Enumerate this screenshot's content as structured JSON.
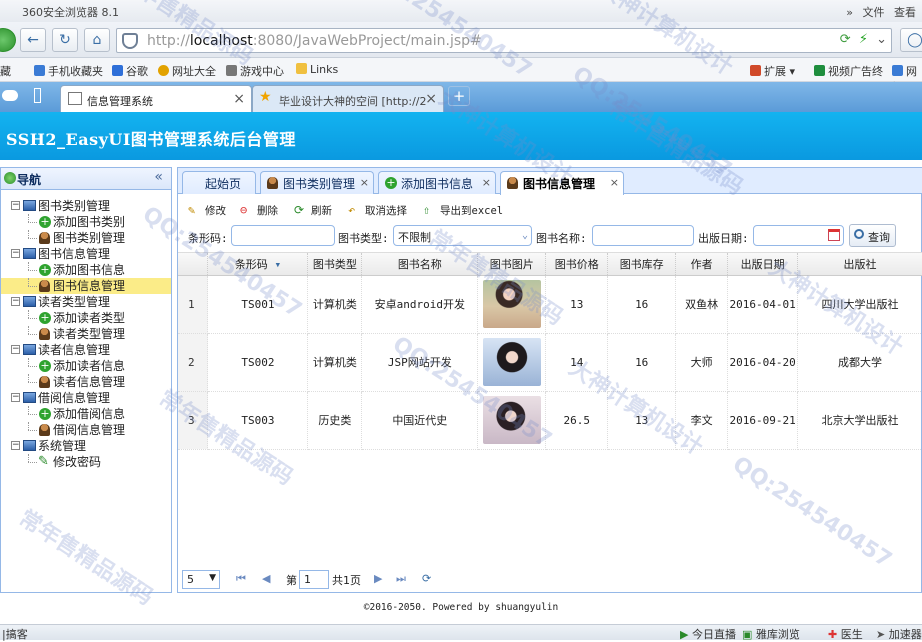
{
  "browser": {
    "window_title": "360安全浏览器 8.1",
    "menu_right": [
      "»",
      "文件",
      "查看"
    ],
    "url_prefix": "http://",
    "url_host": "localhost",
    "url_rest": ":8080/JavaWebProject/main.jsp#",
    "bookmarks": [
      "藏",
      "手机收藏夹",
      "谷歌",
      "网址大全",
      "游戏中心",
      "Links"
    ],
    "bookmarks_right": [
      "扩展",
      "视频广告终",
      "网银"
    ],
    "tabs": [
      {
        "title": "信息管理系统",
        "close": "×"
      },
      {
        "title": "毕业设计大神的空间 [http://2",
        "close": "×"
      }
    ],
    "new_tab": "+"
  },
  "app": {
    "header_title": "SSH2_EasyUI图书管理系统后台管理",
    "nav_title": "导航",
    "nav_collapse": "«",
    "tree": [
      {
        "label": "图书类别管理",
        "children": [
          "添加图书类别",
          "图书类别管理"
        ]
      },
      {
        "label": "图书信息管理",
        "children": [
          "添加图书信息",
          "图书信息管理"
        ]
      },
      {
        "label": "读者类型管理",
        "children": [
          "添加读者类型",
          "读者类型管理"
        ]
      },
      {
        "label": "读者信息管理",
        "children": [
          "添加读者信息",
          "读者信息管理"
        ]
      },
      {
        "label": "借阅信息管理",
        "children": [
          "添加借阅信息",
          "借阅信息管理"
        ]
      },
      {
        "label": "系统管理",
        "children": [
          "修改密码"
        ]
      }
    ],
    "selected_item": "图书信息管理"
  },
  "panel_tabs": [
    {
      "label": "起始页"
    },
    {
      "label": "图书类别管理",
      "close": "×"
    },
    {
      "label": "添加图书信息",
      "close": "×"
    },
    {
      "label": "图书信息管理",
      "close": "×"
    }
  ],
  "toolbar": {
    "edit": "修改",
    "delete": "删除",
    "refresh": "刷新",
    "cancel_select": "取消选择",
    "export": "导出到excel"
  },
  "search": {
    "barcode_label": "条形码:",
    "type_label": "图书类型:",
    "type_value": "不限制",
    "name_label": "图书名称:",
    "date_label": "出版日期:",
    "query_button": "查询"
  },
  "table": {
    "columns": [
      "条形码",
      "图书类型",
      "图书名称",
      "图书图片",
      "图书价格",
      "图书库存",
      "作者",
      "出版日期",
      "出版社"
    ],
    "sort_indicator": "▾",
    "rows": [
      {
        "num": "1",
        "barcode": "TS001",
        "type": "计算机类",
        "name": "安卓android开发",
        "price": "13",
        "stock": "16",
        "author": "双鱼林",
        "date": "2016-04-01",
        "publisher": "四川大学出版社"
      },
      {
        "num": "2",
        "barcode": "TS002",
        "type": "计算机类",
        "name": "JSP网站开发",
        "price": "14",
        "stock": "16",
        "author": "大师",
        "date": "2016-04-20",
        "publisher": "成都大学"
      },
      {
        "num": "3",
        "barcode": "TS003",
        "type": "历史类",
        "name": "中国近代史",
        "price": "26.5",
        "stock": "13",
        "author": "李文",
        "date": "2016-09-21",
        "publisher": "北京大学出版社"
      }
    ]
  },
  "pager": {
    "page_size": "5",
    "page_label": "第",
    "page_value": "1",
    "total_pages": "共1页"
  },
  "footer": "©2016-2050. Powered by shuangyulin",
  "status_bar": {
    "left": "|搞客",
    "right": [
      "今日直播",
      "雅库浏览",
      "医生",
      "加速器"
    ]
  },
  "watermarks": [
    "大神计算机设计",
    "QQ:254540457",
    "常年售精品源码",
    "大神计算机设计",
    "QQ:254540457",
    "常年售精品源码",
    "QQ:254540457",
    "常年售精品源码",
    "大神计算机设计",
    "QQ:254540457",
    "常年售精品源码",
    "大神计算机设计",
    "QQ:254540457",
    "常年售精品源码"
  ]
}
